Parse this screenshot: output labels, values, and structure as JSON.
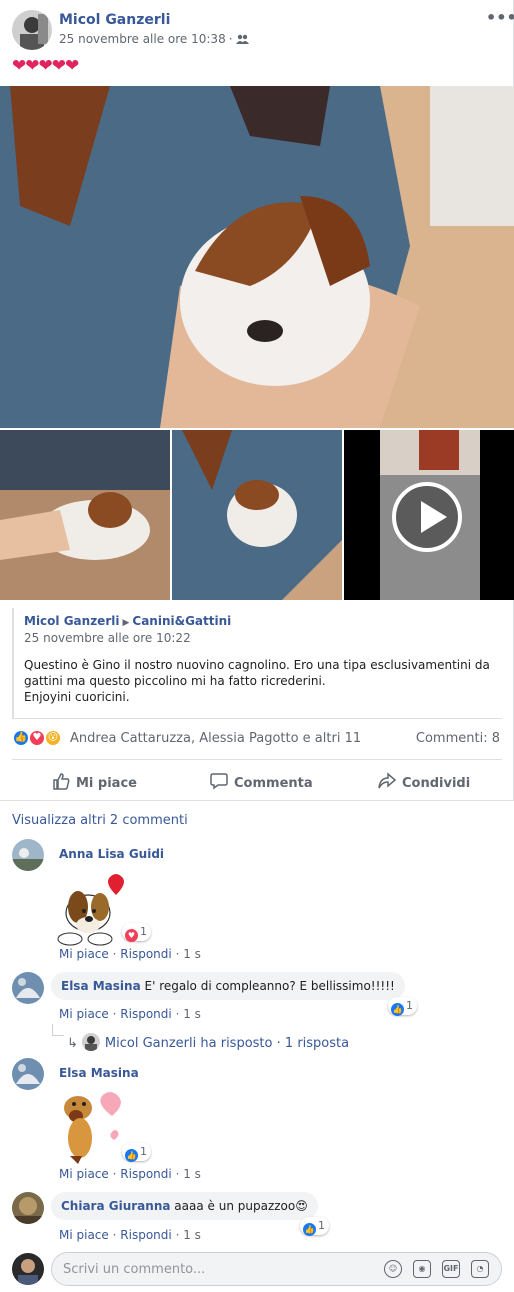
{
  "post": {
    "author": "Micol Ganzerli",
    "date": "25 novembre alle ore 10:38",
    "separator": "·",
    "audience_icon": "friends-icon",
    "menu_label": "•••",
    "text": "❤❤❤❤❤",
    "shared": {
      "author": "Micol Ganzerli",
      "arrow": "▶",
      "group": "Canini&Gattini",
      "date": "25 novembre alle ore 10:22",
      "text": "Questino è Gino il nostro nuovino cagnolino. Ero una tipa esclusivamentini da gattini ma questo piccolino mi ha fatto ricrederini.\nEnjoyini cuoricini."
    },
    "reactions": {
      "icons": [
        "like-icon",
        "love-icon",
        "wow-icon"
      ],
      "names": "Andrea Cattaruzza, Alessia Pagotto e altri 11",
      "comments_count": "Commenti: 8"
    },
    "actions": {
      "like": "Mi piace",
      "comment": "Commenta",
      "share": "Condividi"
    }
  },
  "comments": {
    "view_more": "Visualizza altri 2 commenti",
    "items": [
      {
        "name": "Anna Lisa Guidi",
        "text": "",
        "like": "Mi piace",
        "reply": "Rispondi",
        "time": "1 s",
        "sep": "·",
        "badge": "1",
        "badge_icon": "love-icon",
        "sticker": "beagle-heart-sticker"
      },
      {
        "name": "Elsa Masina",
        "text": "E' regalo di compleanno? E bellissimo!!!!!",
        "like": "Mi piace",
        "reply": "Rispondi",
        "time": "1 s",
        "sep": "·",
        "badge": "1",
        "badge_icon": "like-icon"
      },
      {
        "name": "Elsa Masina",
        "text": "",
        "like": "Mi piace",
        "reply": "Rispondi",
        "time": "1 s",
        "sep": "·",
        "badge": "1",
        "badge_icon": "like-icon",
        "sticker": "dog-hearts-sticker"
      },
      {
        "name": "Chiara Giuranna",
        "text": "aaaa è un pupazzoo😍",
        "like": "Mi piace",
        "reply": "Rispondi",
        "time": "1 s",
        "sep": "·",
        "badge": "1",
        "badge_icon": "like-icon"
      }
    ],
    "reply_thread": {
      "name": "Micol Ganzerli",
      "text": "ha risposto",
      "sep": "·",
      "count": "1 risposta",
      "arrow": "↳"
    },
    "write_placeholder": "Scrivi un commento...",
    "write_icons": [
      "emoji-icon",
      "camera-icon",
      "gif-icon",
      "sticker-icon"
    ]
  },
  "colors": {
    "link": "#385898",
    "meta": "#606770",
    "like": "#1877f2",
    "love": "#f33e58",
    "wow": "#f7b125"
  }
}
